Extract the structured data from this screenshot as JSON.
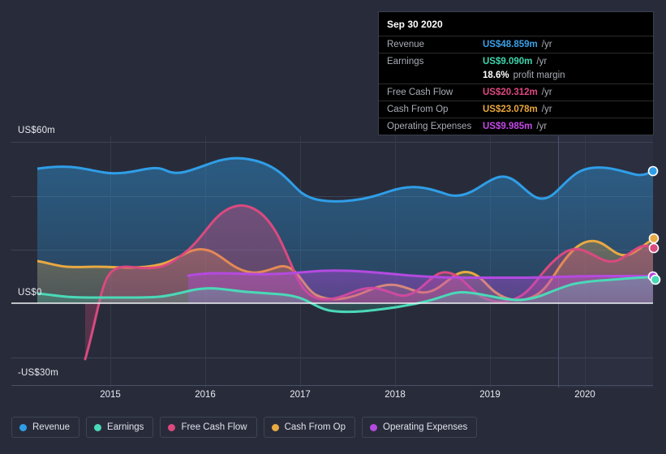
{
  "tooltip": {
    "date": "Sep 30 2020",
    "rows": [
      {
        "name": "Revenue",
        "value": "US$48.859m",
        "unit": "/yr",
        "color": "#3aa0e8"
      },
      {
        "name": "Earnings",
        "value": "US$9.090m",
        "unit": "/yr",
        "color": "#40d6ae"
      },
      {
        "name": "",
        "value": "18.6%",
        "unit": "profit margin",
        "color": "#ffffff"
      },
      {
        "name": "Free Cash Flow",
        "value": "US$20.312m",
        "unit": "/yr",
        "color": "#e0487e"
      },
      {
        "name": "Cash From Op",
        "value": "US$23.078m",
        "unit": "/yr",
        "color": "#e9a63c"
      },
      {
        "name": "Operating Expenses",
        "value": "US$9.985m",
        "unit": "/yr",
        "color": "#c44ae8"
      }
    ]
  },
  "legend": {
    "items": [
      {
        "label": "Revenue",
        "color": "#2f9ee8"
      },
      {
        "label": "Earnings",
        "color": "#4ad9b8"
      },
      {
        "label": "Free Cash Flow",
        "color": "#d94a7f"
      },
      {
        "label": "Cash From Op",
        "color": "#e9a942"
      },
      {
        "label": "Operating Expenses",
        "color": "#b44ae0"
      }
    ]
  },
  "axes": {
    "y_labels": [
      {
        "text": "US$60m",
        "value": 60
      },
      {
        "text": "US$0",
        "value": 0
      },
      {
        "text": "-US$30m",
        "value": -30
      }
    ],
    "x_labels": [
      "2015",
      "2016",
      "2017",
      "2018",
      "2019",
      "2020"
    ]
  },
  "chart_data": {
    "type": "area",
    "title": "",
    "xlabel": "",
    "ylabel": "US$m",
    "ylim": [
      -30,
      60
    ],
    "grid": true,
    "legend_position": "bottom-left",
    "x_tick_labels": [
      "2015",
      "2016",
      "2017",
      "2018",
      "2019",
      "2020"
    ],
    "y_tick_labels": [
      "US$60m",
      "US$0",
      "-US$30m"
    ],
    "units": "US$ millions per year",
    "latest_period": "Sep 30 2020",
    "x": [
      "2014.5",
      "2014.75",
      "2015.0",
      "2015.25",
      "2015.5",
      "2015.75",
      "2016.0",
      "2016.25",
      "2016.5",
      "2016.75",
      "2017.0",
      "2017.25",
      "2017.5",
      "2017.75",
      "2018.0",
      "2018.25",
      "2018.5",
      "2018.75",
      "2019.0",
      "2019.25",
      "2019.5",
      "2019.75",
      "2020.0",
      "2020.25",
      "2020.5",
      "2020.75"
    ],
    "series": [
      {
        "name": "Revenue",
        "color": "#2f9ee8",
        "values": [
          49.0,
          49.5,
          49.2,
          47.8,
          48.6,
          49.4,
          50.5,
          51.5,
          50.8,
          49.6,
          49.0,
          45.0,
          42.3,
          41.5,
          41.0,
          42.0,
          43.8,
          44.3,
          42.8,
          44.5,
          45.8,
          43.5,
          41.2,
          46.2,
          48.3,
          48.859
        ]
      },
      {
        "name": "Earnings",
        "color": "#4ad9b8",
        "values": [
          3.5,
          3.2,
          2.6,
          2.4,
          2.5,
          2.6,
          2.7,
          2.6,
          2.5,
          2.4,
          1.8,
          -0.6,
          -1.4,
          -1.5,
          -1.2,
          -0.9,
          -0.5,
          0.4,
          1.4,
          0.9,
          0.4,
          0.2,
          0.8,
          4.2,
          5.0,
          9.09
        ]
      },
      {
        "name": "Free Cash Flow",
        "color": "#d94a7f",
        "values": [
          -30.0,
          -12.0,
          3.0,
          6.0,
          7.6,
          8.0,
          8.2,
          12.0,
          19.5,
          20.5,
          17.5,
          3.0,
          1.2,
          1.4,
          2.2,
          4.5,
          3.6,
          3.2,
          6.5,
          8.6,
          4.2,
          1.2,
          0.6,
          9.5,
          18.5,
          20.312
        ]
      },
      {
        "name": "Cash From Op",
        "color": "#e9a942",
        "values": [
          7.8,
          7.2,
          6.8,
          6.7,
          6.8,
          6.9,
          7.3,
          9.2,
          11.5,
          11.0,
          9.0,
          2.0,
          2.6,
          3.4,
          4.2,
          5.6,
          4.6,
          4.8,
          8.8,
          11.5,
          7.8,
          3.8,
          3.5,
          12.8,
          21.5,
          23.078
        ]
      },
      {
        "name": "Operating Expenses",
        "color": "#b44ae0",
        "values": [
          null,
          null,
          null,
          null,
          null,
          null,
          10.0,
          10.3,
          10.3,
          10.2,
          10.4,
          10.6,
          10.6,
          10.4,
          10.2,
          10.0,
          9.8,
          9.8,
          9.8,
          9.8,
          9.8,
          9.9,
          10.0,
          10.0,
          10.0,
          9.985
        ]
      }
    ]
  }
}
